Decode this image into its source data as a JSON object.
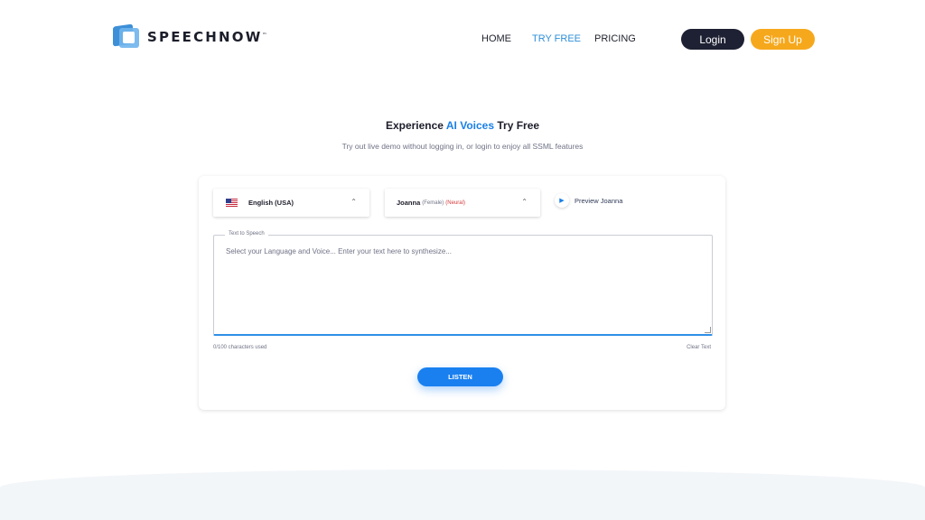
{
  "brand": {
    "name": "SPEECHNOW",
    "tm": "™"
  },
  "nav": {
    "home": "HOME",
    "try_free": "TRY FREE",
    "pricing": "PRICING"
  },
  "auth": {
    "login": "Login",
    "signup": "Sign Up"
  },
  "hero": {
    "title_pre": "Experience ",
    "title_accent": "AI Voices",
    "title_post": " Try Free",
    "subtitle": "Try out live demo without logging in, or login to enjoy all SSML features"
  },
  "demo": {
    "language": "English (USA)",
    "voice_name": "Joanna",
    "voice_gender": "(Female)",
    "voice_type": "(Neural)",
    "preview_label": "Preview Joanna",
    "textarea_label": "Text to Speech",
    "textarea_placeholder": "Select your Language and Voice... Enter your text here to synthesize...",
    "char_count": "0/100 characters used",
    "clear_label": "Clear Text",
    "listen_label": "LISTEN"
  },
  "colors": {
    "accent": "#1a80e6",
    "signup": "#f6a81c",
    "login": "#1e2033"
  },
  "icons": {
    "flag": "us-flag-icon",
    "chevron": "chevron-up-icon",
    "play": "play-icon"
  }
}
